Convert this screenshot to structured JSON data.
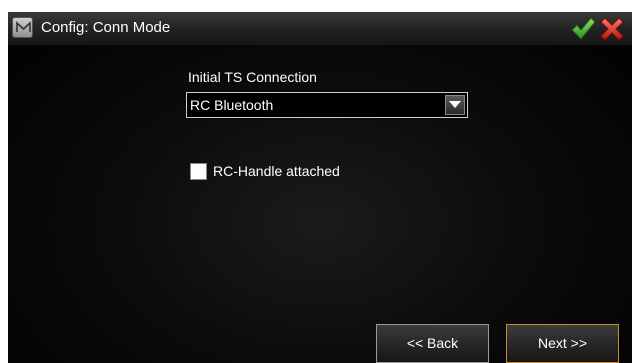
{
  "titlebar": {
    "menu_icon": "m-menu-icon",
    "title": "Config: Conn Mode",
    "ok_icon": "check-icon",
    "cancel_icon": "close-icon",
    "ok_color": "#3fae2a",
    "cancel_color": "#d8281f"
  },
  "connection": {
    "label": "Initial TS Connection",
    "selected": "RC Bluetooth"
  },
  "rc_handle": {
    "label": "RC-Handle attached",
    "checked": false
  },
  "nav": {
    "back_label": "<< Back",
    "next_label": "Next >>",
    "next_border_color": "#c98a2e"
  }
}
